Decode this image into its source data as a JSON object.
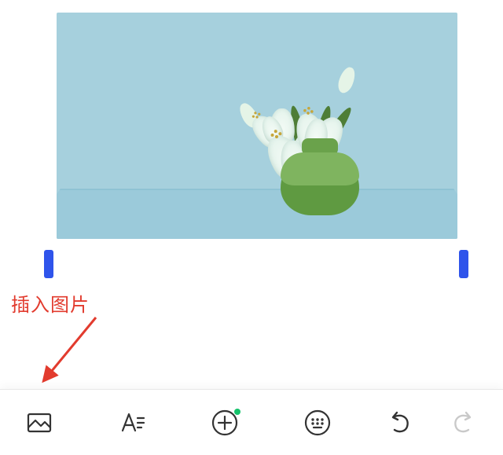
{
  "annotation": {
    "label": "插入图片"
  },
  "toolbar": {
    "insert_image": {
      "name": "image-icon"
    },
    "text_format": {
      "name": "text-format-icon"
    },
    "add": {
      "name": "plus-circle-icon",
      "has_indicator": true
    },
    "keyboard": {
      "name": "keyboard-icon"
    },
    "undo": {
      "name": "undo-icon",
      "enabled": true
    },
    "redo": {
      "name": "redo-icon",
      "enabled": false
    }
  },
  "colors": {
    "annotation": "#e23b2e",
    "selection_handle": "#2f54eb",
    "indicator": "#15c26b"
  }
}
